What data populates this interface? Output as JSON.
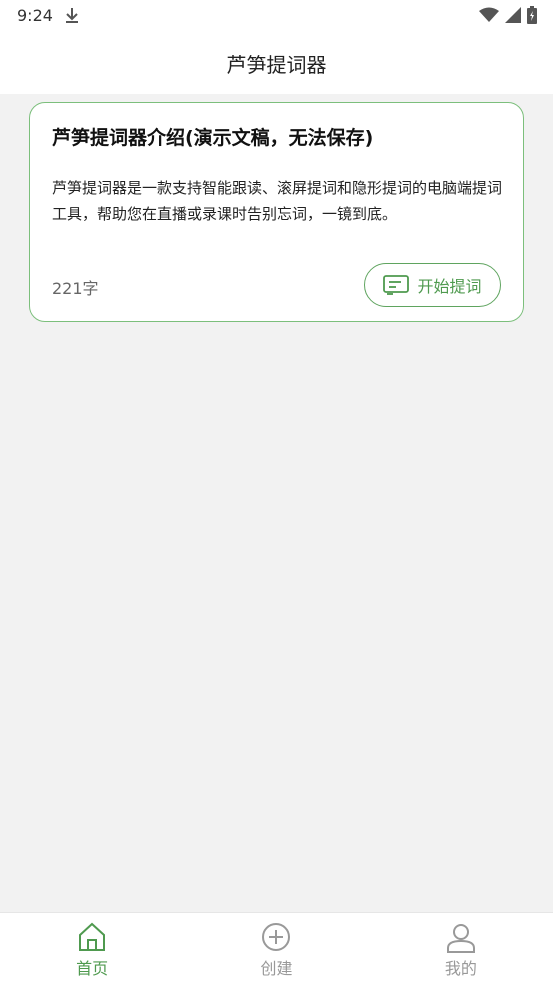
{
  "status_bar": {
    "time": "9:24",
    "icons": [
      "download-icon",
      "wifi-icon",
      "signal-icon",
      "battery-icon"
    ]
  },
  "app_bar": {
    "title": "芦笋提词器"
  },
  "scripts": [
    {
      "title": "芦笋提词器介绍(演示文稿，无法保存)",
      "description": "芦笋提词器是一款支持智能跟读、滚屏提词和隐形提词的电脑端提词工具，帮助您在直播或录课时告别忘词，一镜到底。",
      "word_count": "221字",
      "start_label": "开始提词"
    }
  ],
  "bottom_nav": {
    "items": [
      {
        "label": "首页",
        "icon": "home-icon",
        "active": true
      },
      {
        "label": "创建",
        "icon": "plus-circle-icon",
        "active": false
      },
      {
        "label": "我的",
        "icon": "user-icon",
        "active": false
      }
    ]
  },
  "colors": {
    "accent": "#4f9a4f",
    "card_border": "#7cbf7c",
    "inactive": "#999999",
    "background": "#f2f2f2"
  }
}
